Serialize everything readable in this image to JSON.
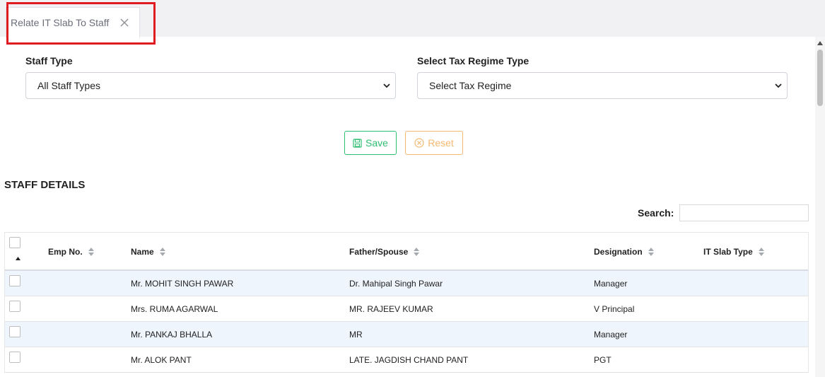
{
  "tab": {
    "label": "Relate IT Slab To Staff"
  },
  "form": {
    "staff_type": {
      "label": "Staff Type",
      "value": "All Staff Types"
    },
    "tax_regime": {
      "label": "Select Tax Regime Type",
      "value": "Select Tax Regime"
    }
  },
  "actions": {
    "save_label": "Save",
    "reset_label": "Reset"
  },
  "section": {
    "title": "STAFF DETAILS"
  },
  "search": {
    "label": "Search:",
    "value": ""
  },
  "table": {
    "columns": {
      "emp_no": "Emp No.",
      "name": "Name",
      "father_spouse": "Father/Spouse",
      "designation": "Designation",
      "it_slab_type": "IT Slab Type"
    },
    "rows": [
      {
        "emp_no": "",
        "name": "Mr. MOHIT SINGH PAWAR",
        "father_spouse": "Dr. Mahipal Singh Pawar",
        "designation": "Manager",
        "it_slab_type": ""
      },
      {
        "emp_no": "",
        "name": "Mrs. RUMA AGARWAL",
        "father_spouse": "MR. RAJEEV KUMAR",
        "designation": "V Principal",
        "it_slab_type": ""
      },
      {
        "emp_no": "",
        "name": "Mr. PANKAJ BHALLA",
        "father_spouse": "MR",
        "designation": "Manager",
        "it_slab_type": ""
      },
      {
        "emp_no": "",
        "name": "Mr. ALOK PANT",
        "father_spouse": "LATE. JAGDISH CHAND PANT",
        "designation": "PGT",
        "it_slab_type": ""
      }
    ]
  },
  "colors": {
    "save": "#2fbf71",
    "reset": "#f5b971",
    "highlight": "#e11b22",
    "row_alt": "#eef5fd"
  }
}
